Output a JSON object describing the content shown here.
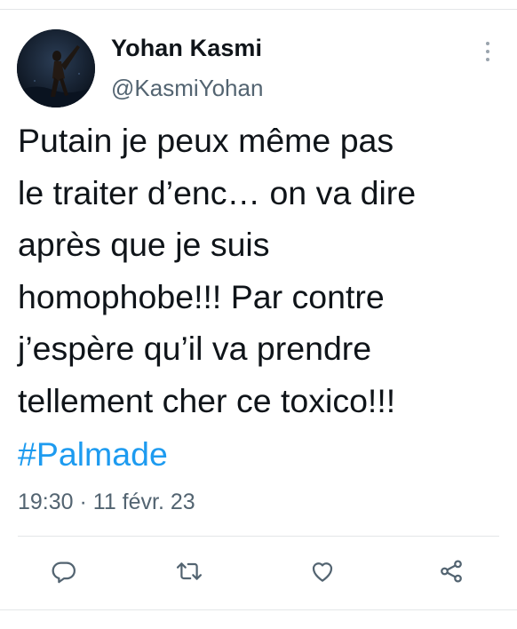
{
  "tweet": {
    "author_name": "Yohan Kasmi",
    "author_handle": "@KasmiYohan",
    "text": "Putain je peux même pas\nle traiter d’enc… on va dire\naprès que je suis\nhomophobe!!! Par contre\nj’espère qu’il va prendre\ntellement cher ce toxico!!!",
    "hashtag": "#Palmade",
    "timestamp": "19:30 · 11 févr. 23"
  },
  "icons": {
    "more": "more-vertical-icon",
    "reply": "reply-icon",
    "retweet": "retweet-icon",
    "like": "heart-icon",
    "share": "share-icon"
  },
  "colors": {
    "text": "#0f1419",
    "secondary": "#536471",
    "link": "#1d9bf0",
    "divider": "#e3e6e8"
  }
}
